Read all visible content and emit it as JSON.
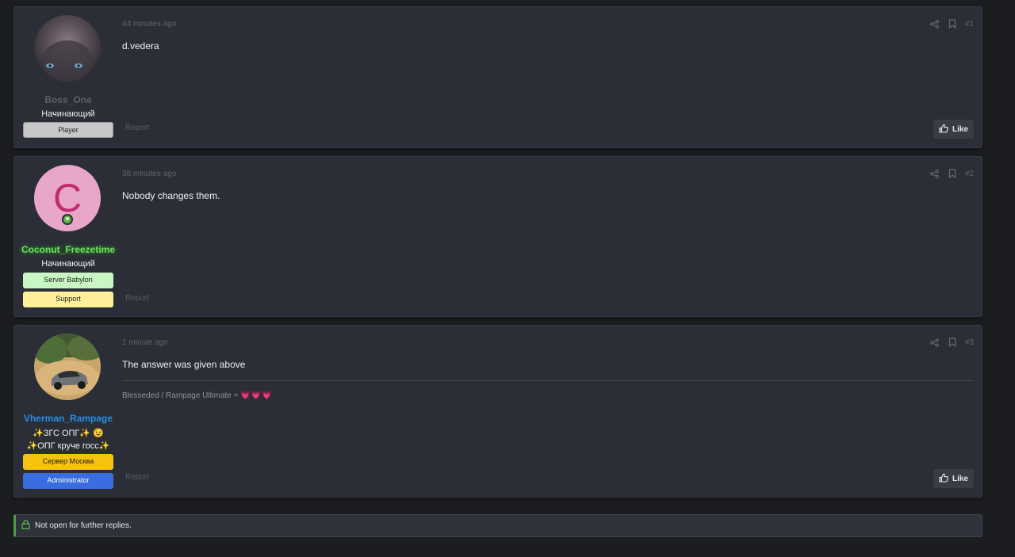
{
  "posts": [
    {
      "username": "Boss_One",
      "username_color": "#5c6069",
      "user_title": "Начинающий",
      "banners": [
        {
          "label": "Player",
          "bg": "#c8c8c8",
          "fg": "#222222"
        }
      ],
      "time": "44 minutes ago",
      "number": "#1",
      "body": "d.vedera",
      "report_label": "Report",
      "like_label": "Like"
    },
    {
      "username": "Coconut_Freezetime",
      "username_color": "#5fe84e",
      "avatar_letter": "C",
      "avatar_bg": "#e8a6c9",
      "avatar_fg": "#c02c6f",
      "user_title": "Начинающий",
      "banners": [
        {
          "label": "Server Babylon",
          "bg": "#c9f7c4",
          "fg": "#1c1c1c"
        },
        {
          "label": "Support",
          "bg": "#ffef9a",
          "fg": "#1c1c1c"
        }
      ],
      "time": "38 minutes ago",
      "number": "#2",
      "body": "Nobody changes them.",
      "report_label": "Report"
    },
    {
      "username": "Vherman_Rampage",
      "username_color": "#2a8de8",
      "user_title_line1": "✨ЗГС ОПГ✨ 😉",
      "user_title_line2": "✨ОПГ круче госс✨",
      "banners": [
        {
          "label": "Сервер Москва",
          "bg": "#f7c10f",
          "fg": "#1c1c1c"
        },
        {
          "label": "Administrator",
          "bg": "#3a6ee0",
          "fg": "#ffffff"
        }
      ],
      "time": "1 minute ago",
      "number": "#3",
      "body": "The answer was given above",
      "signature": "Blesseded / Rampage Ultimate =",
      "signature_hearts": "💗💗💗",
      "report_label": "Report",
      "like_label": "Like"
    }
  ],
  "locked_notice": "Not open for further replies.",
  "icons": {
    "share": "share-icon",
    "bookmark": "bookmark-icon",
    "like": "thumbs-up-icon",
    "lock": "lock-icon",
    "online": "online-status-icon"
  }
}
